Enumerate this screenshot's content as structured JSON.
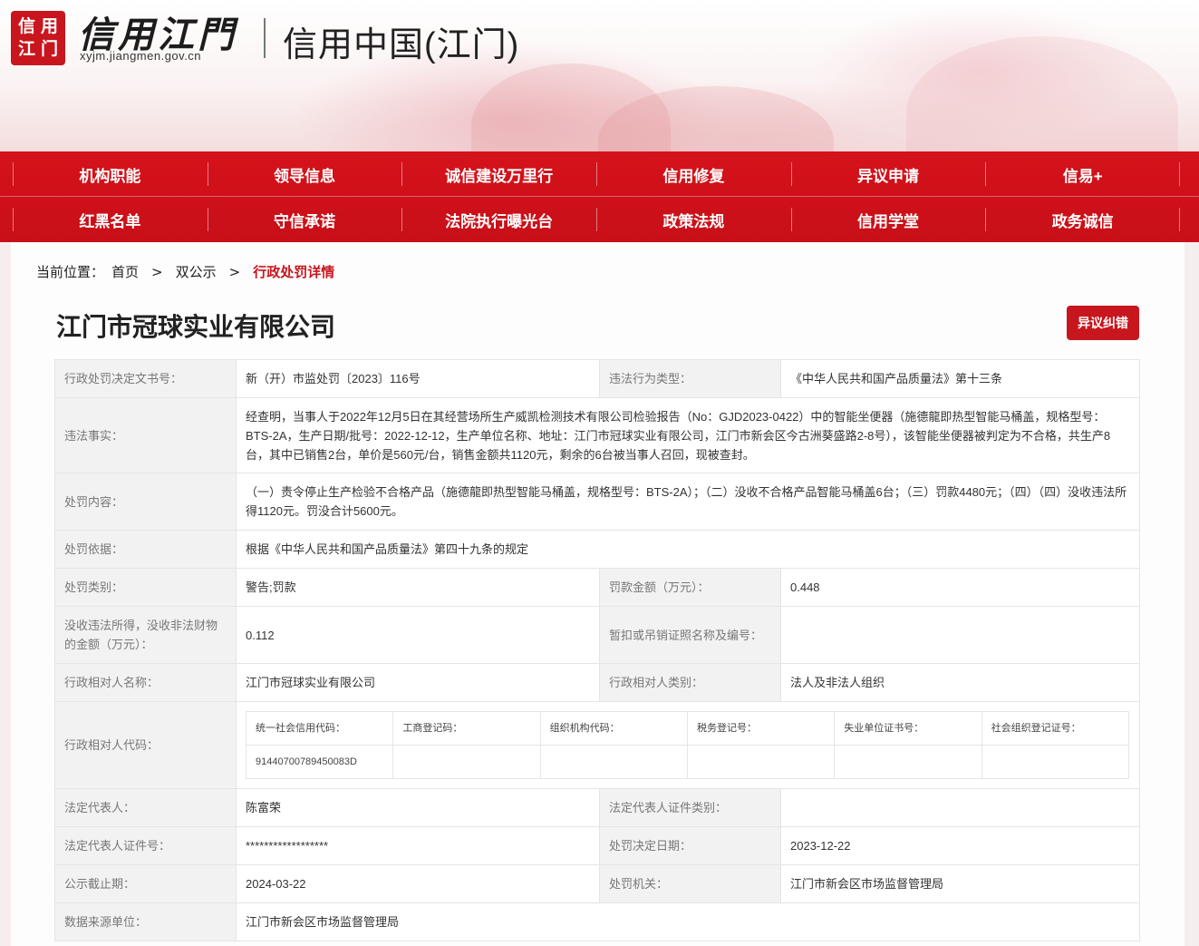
{
  "header": {
    "logo_chars": [
      "信",
      "用",
      "江",
      "门"
    ],
    "logo_title": "信用江門",
    "domain": "xyjm.jiangmen.gov.cn",
    "site_title": "信用中国(江门)"
  },
  "nav": {
    "row1": [
      "机构职能",
      "领导信息",
      "诚信建设万里行",
      "信用修复",
      "异议申请",
      "信易+"
    ],
    "row2": [
      "红黑名单",
      "守信承诺",
      "法院执行曝光台",
      "政策法规",
      "信用学堂",
      "政务诚信"
    ]
  },
  "breadcrumb": {
    "prefix": "当前位置：",
    "items": [
      "首页",
      "双公示"
    ],
    "separator": ">",
    "current": "行政处罚详情"
  },
  "company_name": "江门市冠球实业有限公司",
  "objection_button": "异议纠错",
  "details": {
    "decision_no_label": "行政处罚决定文书号：",
    "decision_no": "新（开）市监处罚〔2023〕116号",
    "violation_type_label": "违法行为类型：",
    "violation_type": "《中华人民共和国产品质量法》第十三条",
    "facts_label": "违法事实：",
    "facts": "经查明，当事人于2022年12月5日在其经营场所生产威凯检测技术有限公司检验报告（No：GJD2023-0422）中的智能坐便器（施德龍即热型智能马桶盖，规格型号：BTS-2A，生产日期/批号：2022-12-12，生产单位名称、地址：江门市冠球实业有限公司，江门市新会区今古洲葵盛路2-8号），该智能坐便器被判定为不合格，共生产8台，其中已销售2台，单价是560元/台，销售金额共1120元，剩余的6台被当事人召回，现被查封。",
    "content_label": "处罚内容：",
    "content": "（一）责令停止生产检验不合格产品（施德龍即热型智能马桶盖，规格型号：BTS-2A）；（二）没收不合格产品智能马桶盖6台；（三）罚款4480元；（四）（四）没收违法所得1120元。罚没合计5600元。",
    "basis_label": "处罚依据：",
    "basis": "根据《中华人民共和国产品质量法》第四十九条的规定",
    "category_label": "处罚类别：",
    "category": "警告;罚款",
    "fine_label": "罚款金额（万元）：",
    "fine": "0.448",
    "confiscated_label": "没收违法所得，没收非法财物的金额（万元）：",
    "confiscated": "0.112",
    "license_label": "暂扣或吊销证照名称及编号：",
    "license": "",
    "party_name_label": "行政相对人名称：",
    "party_name": "江门市冠球实业有限公司",
    "party_type_label": "行政相对人类别：",
    "party_type": "法人及非法人组织",
    "party_code_label": "行政相对人代码：",
    "code_headers": [
      "统一社会信用代码：",
      "工商登记码：",
      "组织机构代码：",
      "税务登记号：",
      "失业单位证书号：",
      "社会组织登记证号："
    ],
    "code_values": [
      "91440700789450083D",
      "",
      "",
      "",
      "",
      ""
    ],
    "legal_rep_label": "法定代表人：",
    "legal_rep": "陈富荣",
    "legal_rep_id_type_label": "法定代表人证件类别：",
    "legal_rep_id_type": "",
    "legal_rep_id_label": "法定代表人证件号：",
    "legal_rep_id": "******************",
    "decision_date_label": "处罚决定日期：",
    "decision_date": "2023-12-22",
    "publicity_deadline_label": "公示截止期：",
    "publicity_deadline": "2024-03-22",
    "authority_label": "处罚机关：",
    "authority": "江门市新会区市场监督管理局",
    "source_label": "数据来源单位：",
    "source": "江门市新会区市场监督管理局"
  }
}
